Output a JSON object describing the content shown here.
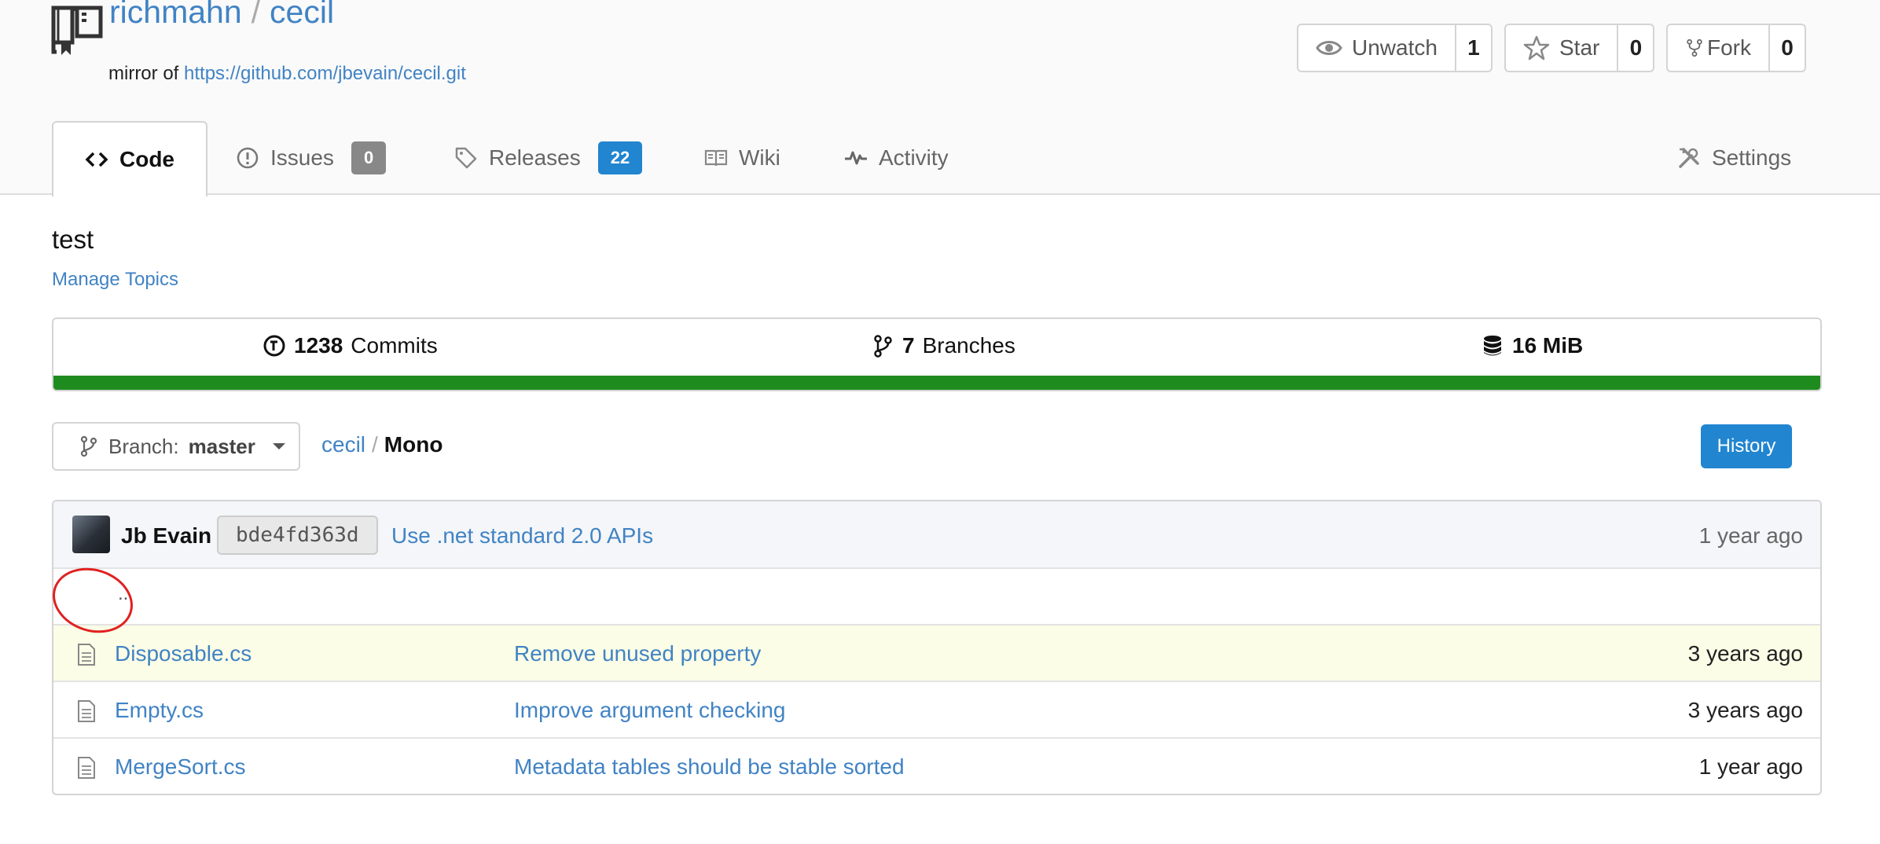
{
  "repo": {
    "owner": "richmahn",
    "separator": "/",
    "name": "cecil",
    "mirror_prefix": "mirror of",
    "mirror_url": "https://github.com/jbevain/cecil.git"
  },
  "actions": {
    "watch": {
      "label": "Unwatch",
      "count": "1"
    },
    "star": {
      "label": "Star",
      "count": "0"
    },
    "fork": {
      "label": "Fork",
      "count": "0"
    }
  },
  "tabs": {
    "code": "Code",
    "issues": {
      "label": "Issues",
      "count": "0"
    },
    "releases": {
      "label": "Releases",
      "count": "22"
    },
    "wiki": "Wiki",
    "activity": "Activity",
    "settings": "Settings"
  },
  "description": "test",
  "manage_topics": "Manage Topics",
  "stats": {
    "commits_count": "1238",
    "commits_label": "Commits",
    "branches_count": "7",
    "branches_label": "Branches",
    "size": "16 MiB",
    "language_bar_color": "#1e8b1e"
  },
  "branch": {
    "prefix": "Branch:",
    "name": "master"
  },
  "breadcrumb": {
    "root": "cecil",
    "separator": "/",
    "current": "Mono"
  },
  "history_label": "History",
  "latest_commit": {
    "author": "Jb Evain",
    "sha": "bde4fd363d",
    "message": "Use .net standard 2.0 APIs",
    "time": "1 year ago"
  },
  "parent_dir": "..",
  "files": [
    {
      "name": "Disposable.cs",
      "message": "Remove unused property",
      "time": "3 years ago"
    },
    {
      "name": "Empty.cs",
      "message": "Improve argument checking",
      "time": "3 years ago"
    },
    {
      "name": "MergeSort.cs",
      "message": "Metadata tables should be stable sorted",
      "time": "1 year ago"
    }
  ],
  "colors": {
    "link": "#4183c4",
    "primary": "#2185d0",
    "annotation": "#e02020"
  }
}
